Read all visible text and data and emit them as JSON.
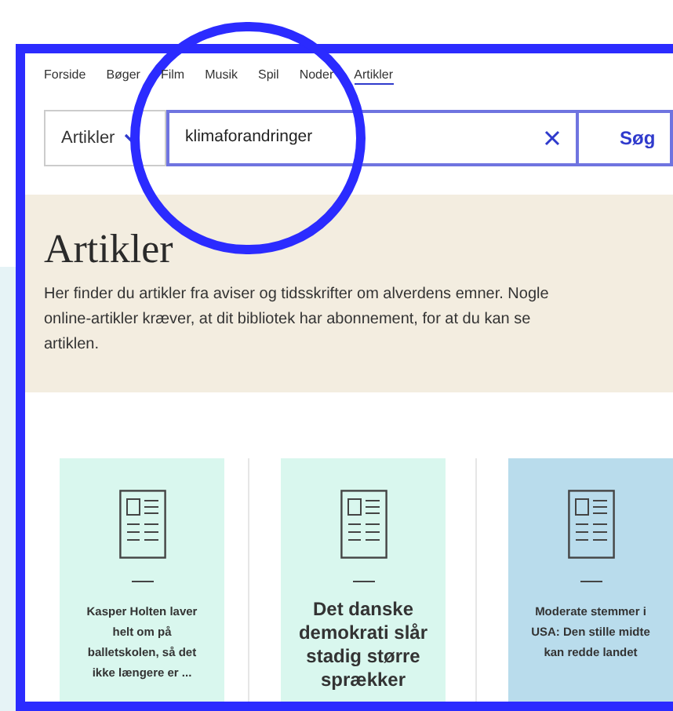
{
  "nav": [
    {
      "label": "Forside",
      "selected": false
    },
    {
      "label": "Bøger",
      "selected": false
    },
    {
      "label": "Film",
      "selected": false
    },
    {
      "label": "Musik",
      "selected": false
    },
    {
      "label": "Spil",
      "selected": false
    },
    {
      "label": "Noder",
      "selected": false
    },
    {
      "label": "Artikler",
      "selected": true
    }
  ],
  "search": {
    "category": "Artikler",
    "value": "klimaforandringer",
    "button": "Søg"
  },
  "intro": {
    "title": "Artikler",
    "text": "Her finder du artikler fra aviser og tidsskrifter om alverdens emner.  Nogle online-artikler kræver, at dit bibliotek har abonnement, for at du kan se artiklen."
  },
  "cards": [
    {
      "title": "Kasper Holten laver helt om på balletskolen, så det ikke længere er ...",
      "kind": "small",
      "color": "#d9f7ee"
    },
    {
      "title": "Det danske demokrati slår stadig større sprækker",
      "kind": "large",
      "color": "#d9f7ee"
    },
    {
      "title": "Moderate stemmer i USA: Den stille midte kan redde landet",
      "kind": "small",
      "color": "#b9dcec"
    }
  ]
}
